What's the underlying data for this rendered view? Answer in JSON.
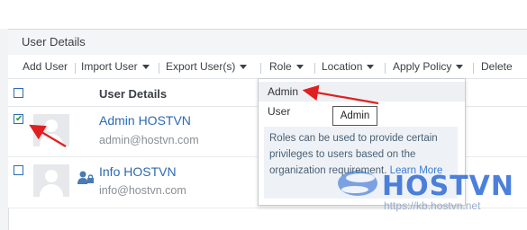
{
  "header": {
    "title": "User Details"
  },
  "toolbar": {
    "add_user": "Add User",
    "import_user": "Import User",
    "export_users": "Export User(s)",
    "role": "Role",
    "location": "Location",
    "apply_policy": "Apply Policy",
    "delete": "Delete"
  },
  "table": {
    "column_title": "User Details"
  },
  "users": [
    {
      "name": "Admin HOSTVN",
      "email": "admin@hostvn.com",
      "selected": true
    },
    {
      "name": "Info HOSTVN",
      "email": "info@hostvn.com",
      "selected": false
    }
  ],
  "role_dropdown": {
    "options": [
      "Admin",
      "User"
    ],
    "highlighted": "Admin",
    "info_text": "Roles can be used to provide certain privileges to users based on the organization requirement.",
    "learn_more": "Learn More"
  },
  "tooltip": {
    "text": "Admin"
  },
  "watermark": {
    "brand": "HOSTVN",
    "url": "https://kb.hostvn.net"
  },
  "colors": {
    "accent": "#2a6ab2",
    "annotation_arrow": "#e02020",
    "watermark": "#2f6bd6"
  }
}
